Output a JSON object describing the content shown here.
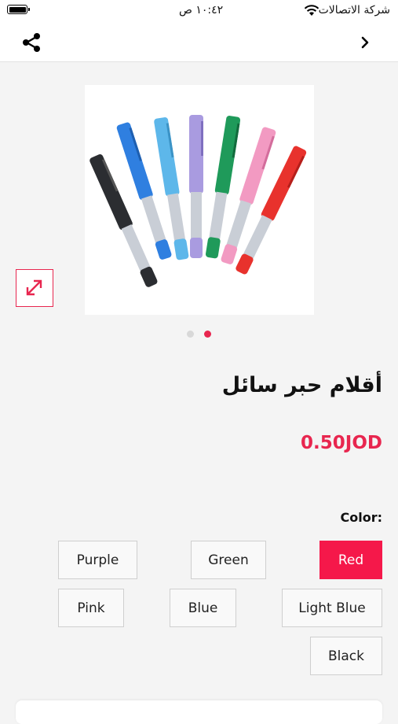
{
  "status_bar": {
    "carrier": "شركة الاتصالات",
    "time": "١٠:٤٢ ص"
  },
  "nav": {
    "share_icon": "share-icon",
    "back_icon": "chevron-right-icon"
  },
  "product": {
    "title": "أقلام حبر سائل",
    "price": "0.50JOD",
    "image_subject": "pens-product-photo",
    "carousel": {
      "total": 2,
      "active": 2
    }
  },
  "colors": {
    "label": "Color:",
    "options": [
      "Red",
      "Green",
      "Purple",
      "Light Blue",
      "Blue",
      "Pink",
      "Black"
    ],
    "selected": "Red"
  },
  "theme": {
    "accent": "#e8264f",
    "selected_bg": "#f5184a"
  }
}
